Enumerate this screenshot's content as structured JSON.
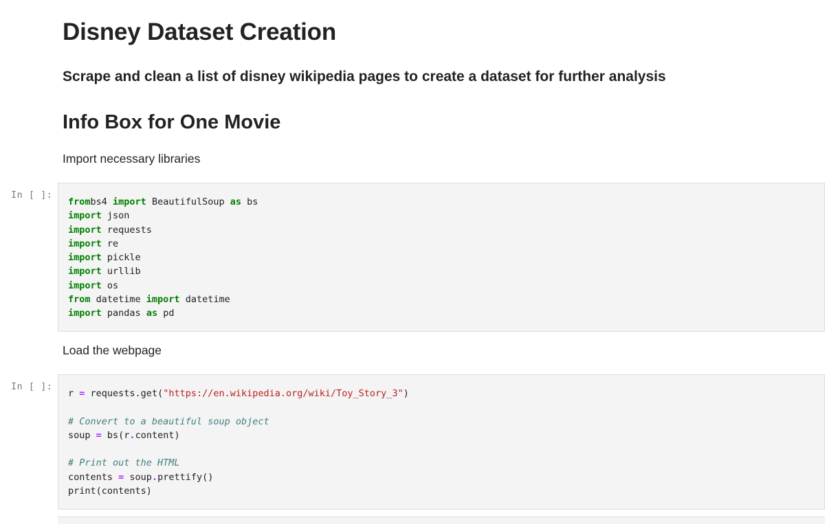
{
  "notebook": {
    "title": "Disney Dataset Creation",
    "subtitle": "Scrape and clean a list of disney wikipedia pages to create a dataset for further analysis",
    "section_heading": "Info Box for One Movie",
    "markdown_1": "Import necessary libraries",
    "markdown_2": "Load the webpage"
  },
  "cells": [
    {
      "prompt": "In [ ]:",
      "lines": [
        [
          [
            "kw",
            "from"
          ],
          [
            "",
            "bs4 "
          ],
          [
            "kw",
            "import"
          ],
          [
            "",
            " BeautifulSoup "
          ],
          [
            "kw",
            "as"
          ],
          [
            "",
            " bs"
          ]
        ],
        [
          [
            "kw",
            "import"
          ],
          [
            "",
            " json"
          ]
        ],
        [
          [
            "kw",
            "import"
          ],
          [
            "",
            " requests"
          ]
        ],
        [
          [
            "kw",
            "import"
          ],
          [
            "",
            " re"
          ]
        ],
        [
          [
            "kw",
            "import"
          ],
          [
            "",
            " pickle"
          ]
        ],
        [
          [
            "kw",
            "import"
          ],
          [
            "",
            " urllib"
          ]
        ],
        [
          [
            "kw",
            "import"
          ],
          [
            "",
            " os"
          ]
        ],
        [
          [
            "kw",
            "from"
          ],
          [
            "",
            " datetime "
          ],
          [
            "kw",
            "import"
          ],
          [
            "",
            " datetime"
          ]
        ],
        [
          [
            "kw",
            "import"
          ],
          [
            "",
            " pandas "
          ],
          [
            "kw",
            "as"
          ],
          [
            "",
            " pd"
          ]
        ]
      ]
    },
    {
      "prompt": "In [ ]:",
      "lines": [
        [
          [
            "",
            "r "
          ],
          [
            "op",
            "="
          ],
          [
            "",
            " requests.get("
          ],
          [
            "str",
            "\"https://en.wikipedia.org/wiki/Toy_Story_3\""
          ],
          [
            "",
            ")"
          ]
        ],
        [],
        [
          [
            "cm",
            "# Convert to a beautiful soup object"
          ]
        ],
        [
          [
            "",
            "soup "
          ],
          [
            "op",
            "="
          ],
          [
            "",
            " bs(r"
          ],
          [
            "op",
            "."
          ],
          [
            "",
            "content)"
          ]
        ],
        [],
        [
          [
            "cm",
            "# Print out the HTML"
          ]
        ],
        [
          [
            "",
            "contents "
          ],
          [
            "op",
            "="
          ],
          [
            "",
            " soup"
          ],
          [
            "op",
            "."
          ],
          [
            "",
            "prettify()"
          ]
        ],
        [
          [
            "",
            "print(contents)"
          ]
        ]
      ]
    }
  ]
}
